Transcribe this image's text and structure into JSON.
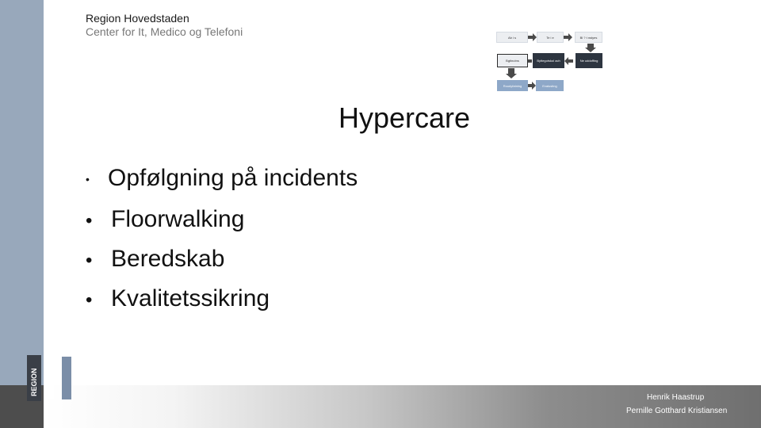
{
  "header": {
    "organization": "Region Hovedstaden",
    "department": "Center for It, Medico og Telefoni"
  },
  "slide": {
    "title": "Hypercare",
    "bullets": [
      "Opfølgning på incidents",
      "Floorwalking",
      "Beredskab",
      "Kvalitetssikring"
    ]
  },
  "process_diagram": {
    "boxes": [
      {
        "label": "Ab i s"
      },
      {
        "label": "Te i e"
      },
      {
        "label": "Bl ? t nstyes"
      },
      {
        "label": "Bgtinutns"
      },
      {
        "label": "Byttegotskol ach"
      },
      {
        "label": "Ne uddoffing"
      },
      {
        "label": "Roudyfatning"
      },
      {
        "label": "Evalusting"
      }
    ]
  },
  "logo": {
    "text": "REGION",
    "color": "#7b8ea8"
  },
  "footer": {
    "author1": "Henrik Haastrup",
    "author2": "Pernille Gotthard Kristiansen"
  }
}
